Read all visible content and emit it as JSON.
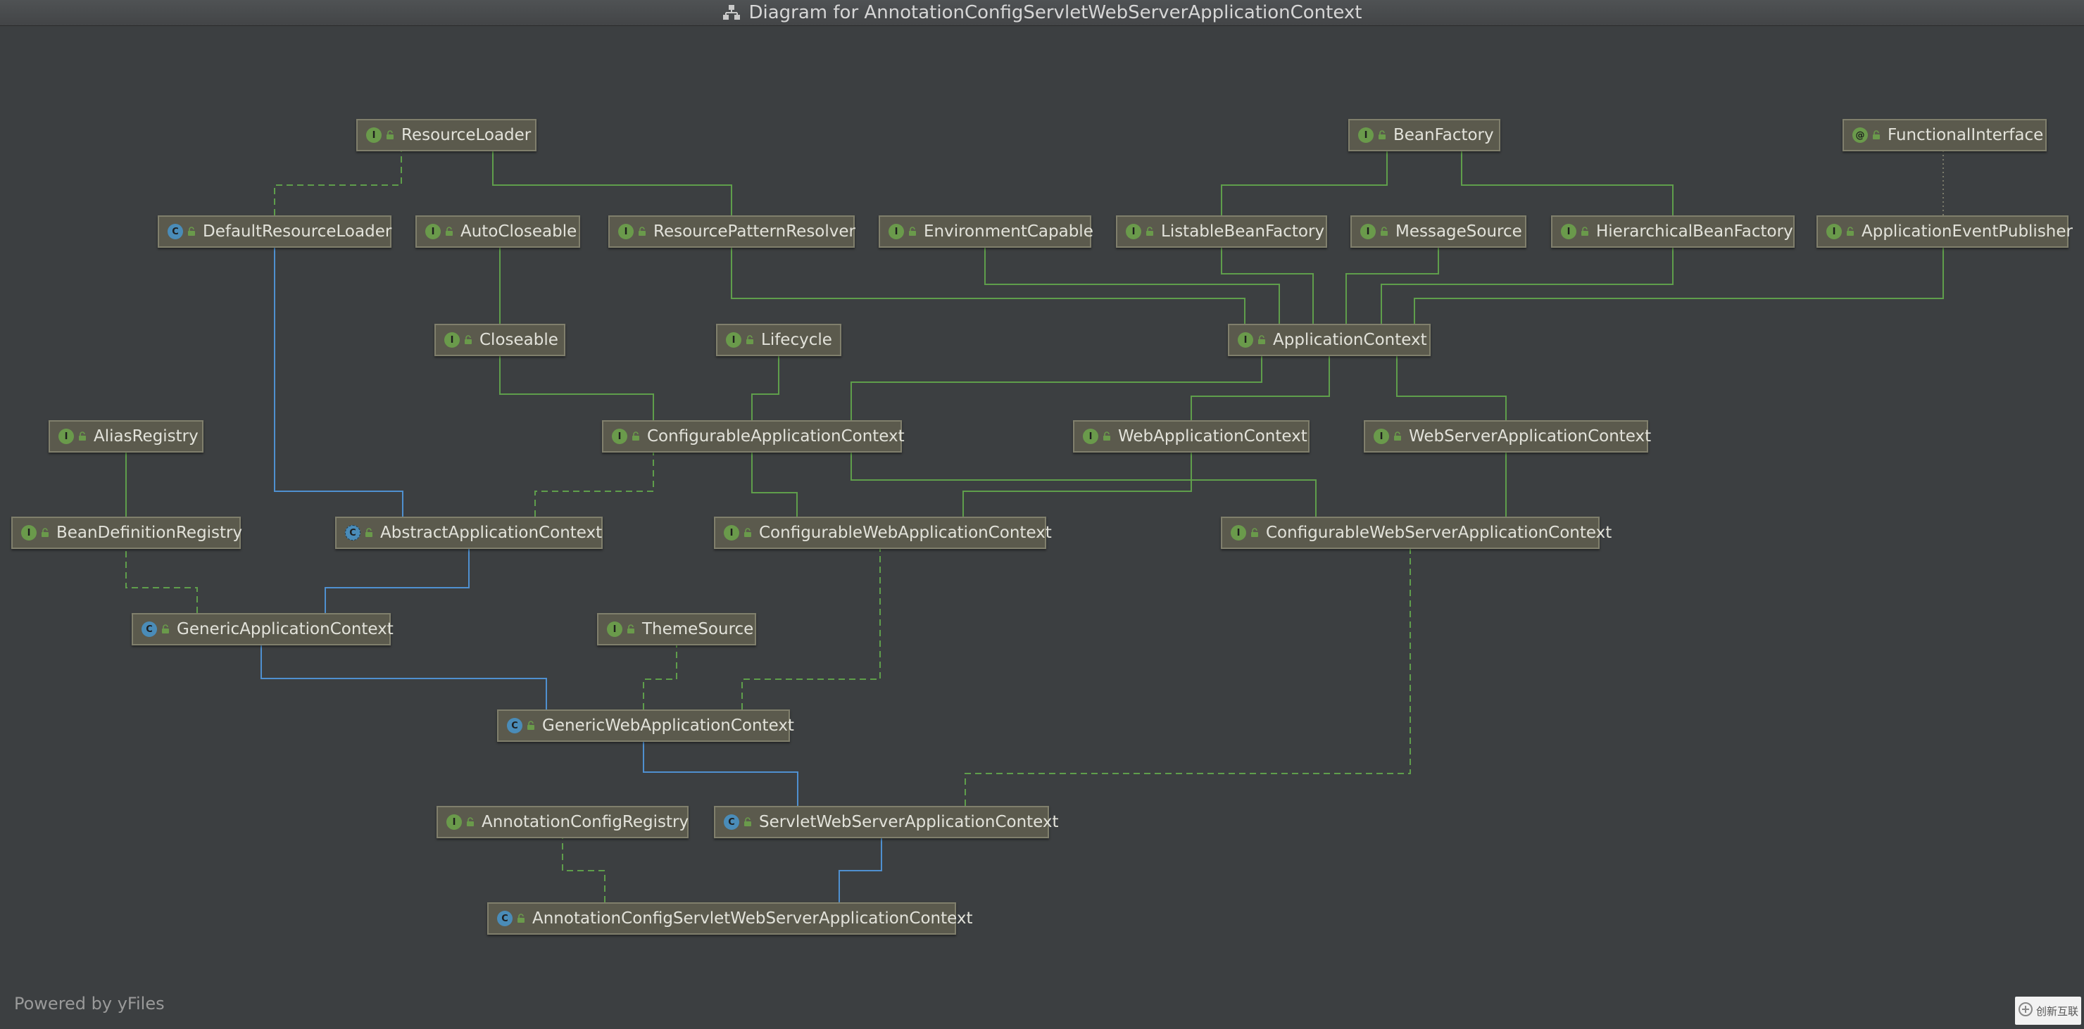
{
  "window": {
    "title": "Diagram for AnnotationConfigServletWebServerApplicationContext",
    "title_icon": "hierarchy-diagram-icon"
  },
  "colors": {
    "background": "#3c3f41",
    "node_fill": "#5b5a4d",
    "node_border": "#807f6c",
    "interface_badge": "#6a9a4b",
    "class_badge": "#4a8cb8",
    "extends_edge": "#5f9e4b",
    "implements_class_edge": "#4f90d0"
  },
  "nodes": [
    {
      "id": "ResourceLoader",
      "label": "ResourceLoader",
      "kind": "I"
    },
    {
      "id": "BeanFactory",
      "label": "BeanFactory",
      "kind": "I"
    },
    {
      "id": "FunctionalInterface",
      "label": "FunctionalInterface",
      "kind": "AT"
    },
    {
      "id": "DefaultResourceLoader",
      "label": "DefaultResourceLoader",
      "kind": "C"
    },
    {
      "id": "AutoCloseable",
      "label": "AutoCloseable",
      "kind": "I"
    },
    {
      "id": "ResourcePatternResolver",
      "label": "ResourcePatternResolver",
      "kind": "I"
    },
    {
      "id": "EnvironmentCapable",
      "label": "EnvironmentCapable",
      "kind": "I"
    },
    {
      "id": "ListableBeanFactory",
      "label": "ListableBeanFactory",
      "kind": "I"
    },
    {
      "id": "MessageSource",
      "label": "MessageSource",
      "kind": "I"
    },
    {
      "id": "HierarchicalBeanFactory",
      "label": "HierarchicalBeanFactory",
      "kind": "I"
    },
    {
      "id": "ApplicationEventPublisher",
      "label": "ApplicationEventPublisher",
      "kind": "I"
    },
    {
      "id": "Closeable",
      "label": "Closeable",
      "kind": "I"
    },
    {
      "id": "Lifecycle",
      "label": "Lifecycle",
      "kind": "I"
    },
    {
      "id": "ApplicationContext",
      "label": "ApplicationContext",
      "kind": "I"
    },
    {
      "id": "AliasRegistry",
      "label": "AliasRegistry",
      "kind": "I"
    },
    {
      "id": "ConfigurableApplicationContext",
      "label": "ConfigurableApplicationContext",
      "kind": "I"
    },
    {
      "id": "WebApplicationContext",
      "label": "WebApplicationContext",
      "kind": "I"
    },
    {
      "id": "WebServerApplicationContext",
      "label": "WebServerApplicationContext",
      "kind": "I"
    },
    {
      "id": "BeanDefinitionRegistry",
      "label": "BeanDefinitionRegistry",
      "kind": "I"
    },
    {
      "id": "AbstractApplicationContext",
      "label": "AbstractApplicationContext",
      "kind": "A"
    },
    {
      "id": "ConfigurableWebApplicationContext",
      "label": "ConfigurableWebApplicationContext",
      "kind": "I"
    },
    {
      "id": "ConfigurableWebServerApplicationContext",
      "label": "ConfigurableWebServerApplicationContext",
      "kind": "I"
    },
    {
      "id": "GenericApplicationContext",
      "label": "GenericApplicationContext",
      "kind": "C"
    },
    {
      "id": "ThemeSource",
      "label": "ThemeSource",
      "kind": "I"
    },
    {
      "id": "GenericWebApplicationContext",
      "label": "GenericWebApplicationContext",
      "kind": "C"
    },
    {
      "id": "AnnotationConfigRegistry",
      "label": "AnnotationConfigRegistry",
      "kind": "I"
    },
    {
      "id": "ServletWebServerApplicationContext",
      "label": "ServletWebServerApplicationContext",
      "kind": "C"
    },
    {
      "id": "AnnotationConfigServletWebServerApplicationContext",
      "label": "AnnotationConfigServletWebServerApplicationContext",
      "kind": "C"
    }
  ],
  "edges": [
    {
      "from": "DefaultResourceLoader",
      "to": "ResourceLoader",
      "type": "implements"
    },
    {
      "from": "ResourcePatternResolver",
      "to": "ResourceLoader",
      "type": "extends"
    },
    {
      "from": "ListableBeanFactory",
      "to": "BeanFactory",
      "type": "extends"
    },
    {
      "from": "HierarchicalBeanFactory",
      "to": "BeanFactory",
      "type": "extends"
    },
    {
      "from": "ApplicationEventPublisher",
      "to": "FunctionalInterface",
      "type": "annotation"
    },
    {
      "from": "Closeable",
      "to": "AutoCloseable",
      "type": "extends"
    },
    {
      "from": "ApplicationContext",
      "to": "ResourcePatternResolver",
      "type": "extends"
    },
    {
      "from": "ApplicationContext",
      "to": "EnvironmentCapable",
      "type": "extends"
    },
    {
      "from": "ApplicationContext",
      "to": "ListableBeanFactory",
      "type": "extends"
    },
    {
      "from": "ApplicationContext",
      "to": "MessageSource",
      "type": "extends"
    },
    {
      "from": "ApplicationContext",
      "to": "HierarchicalBeanFactory",
      "type": "extends"
    },
    {
      "from": "ApplicationContext",
      "to": "ApplicationEventPublisher",
      "type": "extends"
    },
    {
      "from": "ConfigurableApplicationContext",
      "to": "Closeable",
      "type": "extends"
    },
    {
      "from": "ConfigurableApplicationContext",
      "to": "Lifecycle",
      "type": "extends"
    },
    {
      "from": "ConfigurableApplicationContext",
      "to": "ApplicationContext",
      "type": "extends"
    },
    {
      "from": "WebApplicationContext",
      "to": "ApplicationContext",
      "type": "extends"
    },
    {
      "from": "WebServerApplicationContext",
      "to": "ApplicationContext",
      "type": "extends"
    },
    {
      "from": "BeanDefinitionRegistry",
      "to": "AliasRegistry",
      "type": "extends"
    },
    {
      "from": "AbstractApplicationContext",
      "to": "DefaultResourceLoader",
      "type": "class-extends"
    },
    {
      "from": "AbstractApplicationContext",
      "to": "ConfigurableApplicationContext",
      "type": "implements"
    },
    {
      "from": "ConfigurableWebApplicationContext",
      "to": "ConfigurableApplicationContext",
      "type": "extends"
    },
    {
      "from": "ConfigurableWebApplicationContext",
      "to": "WebApplicationContext",
      "type": "extends"
    },
    {
      "from": "ConfigurableWebServerApplicationContext",
      "to": "ConfigurableApplicationContext",
      "type": "extends"
    },
    {
      "from": "ConfigurableWebServerApplicationContext",
      "to": "WebServerApplicationContext",
      "type": "extends"
    },
    {
      "from": "GenericApplicationContext",
      "to": "BeanDefinitionRegistry",
      "type": "implements"
    },
    {
      "from": "GenericApplicationContext",
      "to": "AbstractApplicationContext",
      "type": "class-extends"
    },
    {
      "from": "GenericWebApplicationContext",
      "to": "GenericApplicationContext",
      "type": "class-extends"
    },
    {
      "from": "GenericWebApplicationContext",
      "to": "ThemeSource",
      "type": "implements"
    },
    {
      "from": "GenericWebApplicationContext",
      "to": "ConfigurableWebApplicationContext",
      "type": "implements"
    },
    {
      "from": "ServletWebServerApplicationContext",
      "to": "GenericWebApplicationContext",
      "type": "class-extends"
    },
    {
      "from": "ServletWebServerApplicationContext",
      "to": "ConfigurableWebServerApplicationContext",
      "type": "implements"
    },
    {
      "from": "AnnotationConfigServletWebServerApplicationContext",
      "to": "AnnotationConfigRegistry",
      "type": "implements"
    },
    {
      "from": "AnnotationConfigServletWebServerApplicationContext",
      "to": "ServletWebServerApplicationContext",
      "type": "class-extends"
    }
  ],
  "footer": {
    "powered_by": "Powered by yFiles",
    "watermark": "创新互联",
    "watermark_icon": "brand-logo-icon"
  }
}
